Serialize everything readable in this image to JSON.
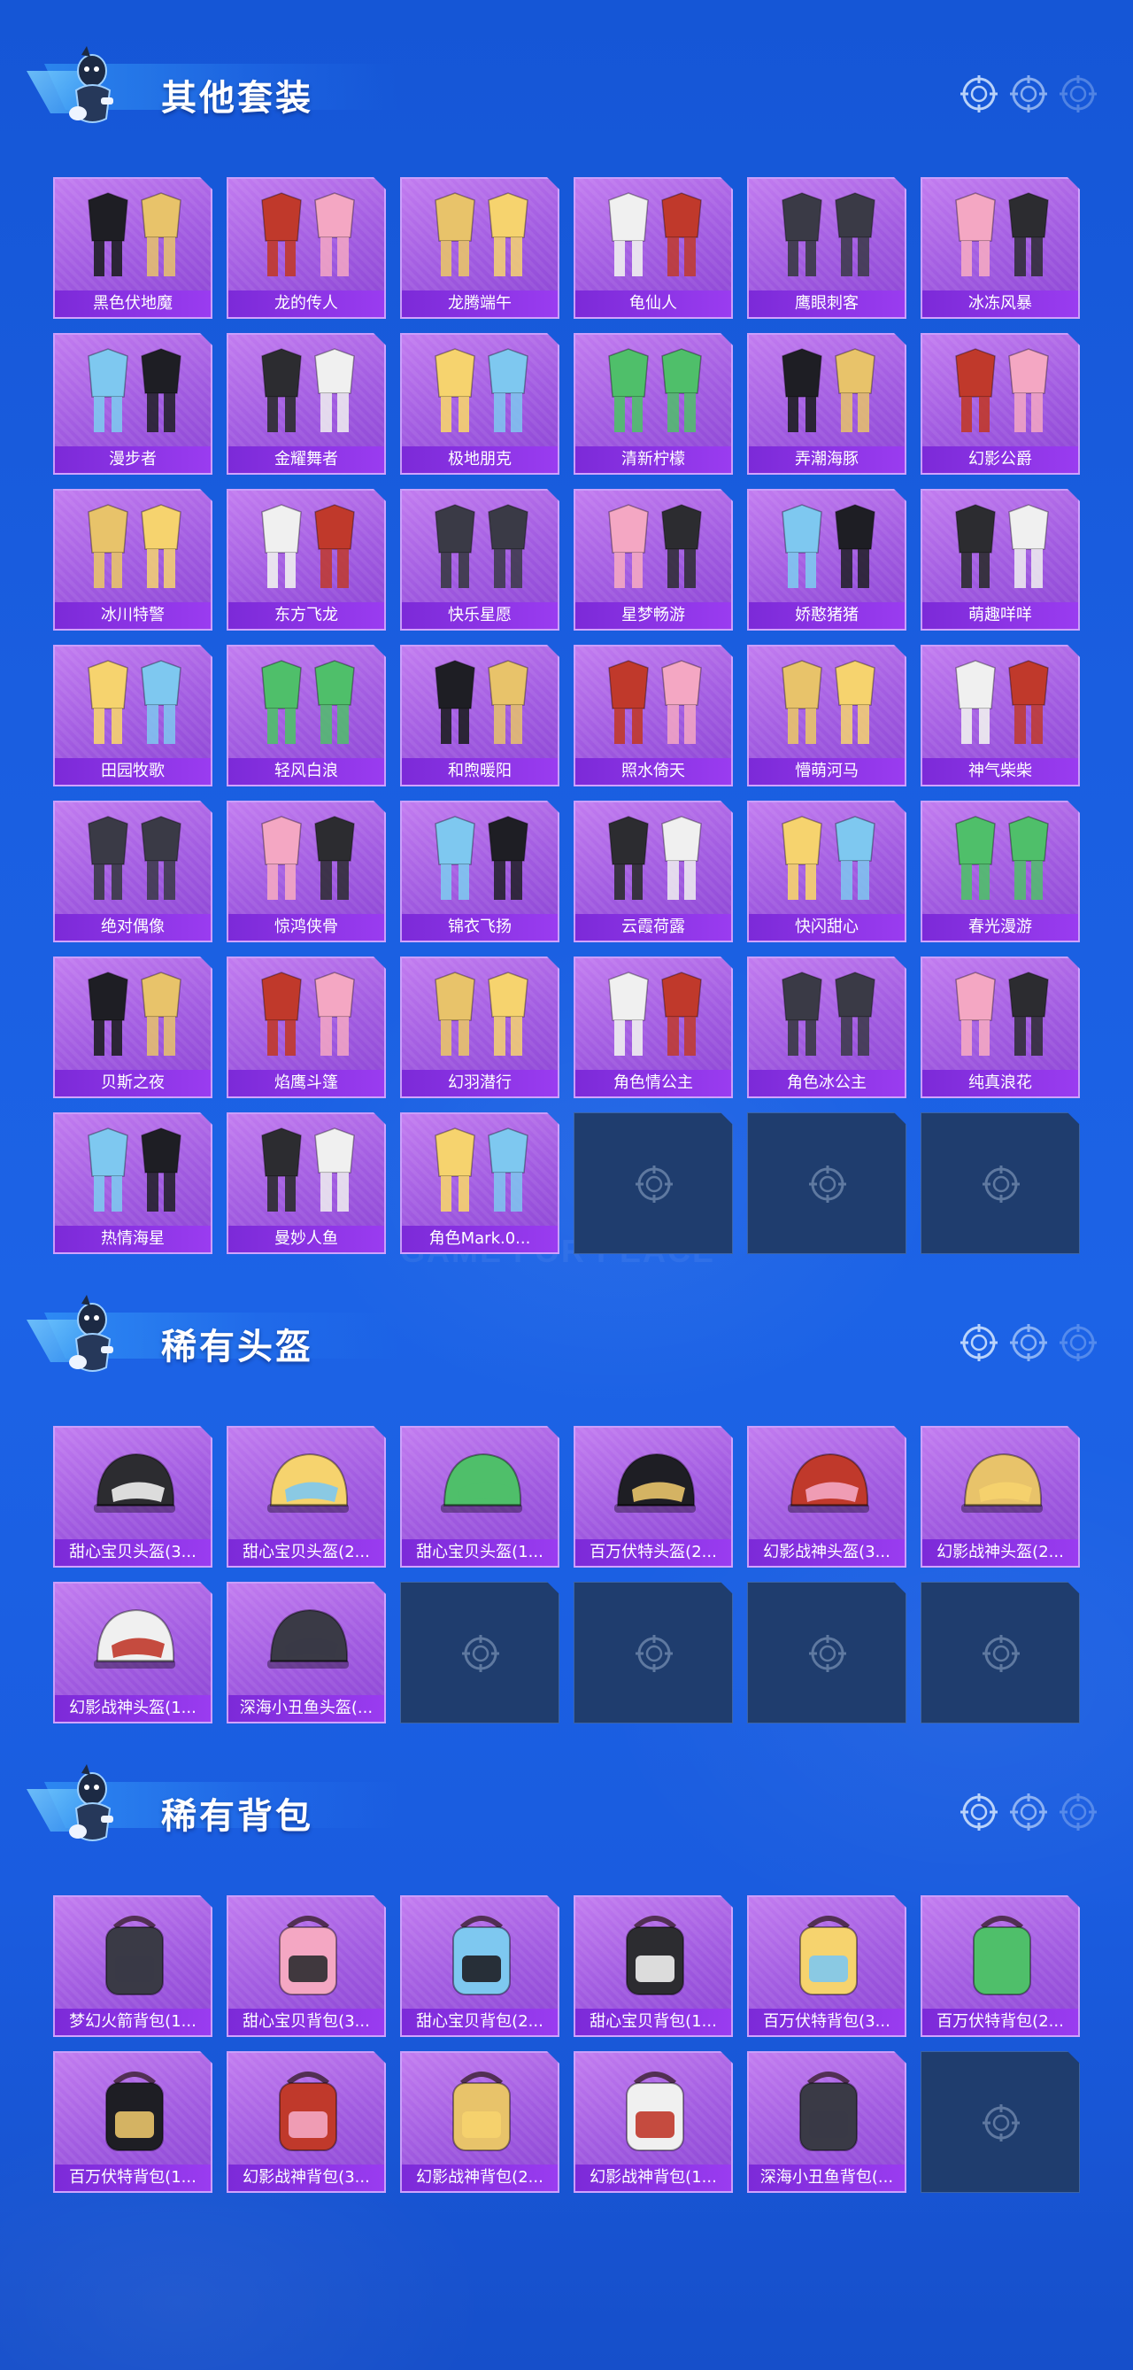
{
  "decor": {
    "watermark": "GAME FOR PEACE"
  },
  "sections": [
    {
      "id": "outfits",
      "title": "其他套装",
      "art": "outfit",
      "items": [
        "黑色伏地魔",
        "龙的传人",
        "龙腾端午",
        "龟仙人",
        "鹰眼刺客",
        "冰冻风暴",
        "漫步者",
        "金耀舞者",
        "极地朋克",
        "清新柠檬",
        "弄潮海豚",
        "幻影公爵",
        "冰川特警",
        "东方飞龙",
        "快乐星愿",
        "星梦畅游",
        "娇憨猪猪",
        "萌趣咩咩",
        "田园牧歌",
        "轻风白浪",
        "和煦暖阳",
        "照水倚天",
        "懵萌河马",
        "神气柴柴",
        "绝对偶像",
        "惊鸿侠骨",
        "锦衣飞扬",
        "云霞荷露",
        "快闪甜心",
        "春光漫游",
        "贝斯之夜",
        "焰鹰斗篷",
        "幻羽潜行",
        "角色情公主",
        "角色冰公主",
        "纯真浪花",
        "热情海星",
        "曼妙人鱼",
        "角色Mark.0..."
      ],
      "empty_slots": 3
    },
    {
      "id": "helmets",
      "title": "稀有头盔",
      "art": "helmet",
      "items": [
        "甜心宝贝头盔(3...",
        "甜心宝贝头盔(2...",
        "甜心宝贝头盔(1...",
        "百万伏特头盔(2...",
        "幻影战神头盔(3...",
        "幻影战神头盔(2...",
        "幻影战神头盔(1...",
        "深海小丑鱼头盔(..."
      ],
      "empty_slots": 4
    },
    {
      "id": "backpacks",
      "title": "稀有背包",
      "art": "backpack",
      "items": [
        "梦幻火箭背包(1...",
        "甜心宝贝背包(3...",
        "甜心宝贝背包(2...",
        "甜心宝贝背包(1...",
        "百万伏特背包(3...",
        "百万伏特背包(2...",
        "百万伏特背包(1...",
        "幻影战神背包(3...",
        "幻影战神背包(2...",
        "幻影战神背包(1...",
        "深海小丑鱼背包(..."
      ],
      "empty_slots": 1
    }
  ],
  "icons": {
    "mascot": "mascot-icon",
    "target": "target-icon",
    "empty_slot": "target-icon"
  },
  "colors": {
    "background": "#1a5ee0",
    "card_purple": "#a05ae0",
    "label_purple": "#8a34e6",
    "empty_slot": "#1f3d6e"
  }
}
